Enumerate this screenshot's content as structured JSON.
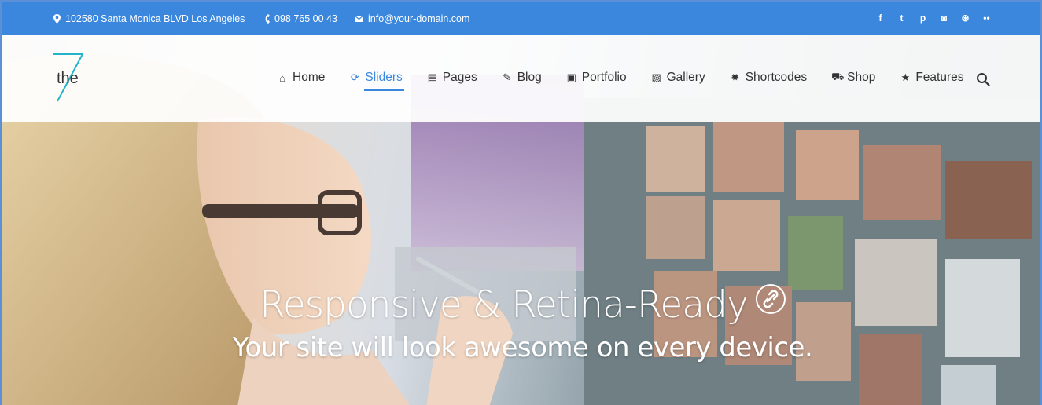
{
  "topbar": {
    "address": "102580 Santa Monica BLVD Los Angeles",
    "phone": "098 765 00 43",
    "email": "info@your-domain.com",
    "background": "#3b87de",
    "social": [
      {
        "icon": "facebook-icon",
        "glyph": "f"
      },
      {
        "icon": "twitter-icon",
        "glyph": "t"
      },
      {
        "icon": "pinterest-icon",
        "glyph": "p"
      },
      {
        "icon": "instagram-icon",
        "glyph": "◙"
      },
      {
        "icon": "dribbble-icon",
        "glyph": "⊛"
      },
      {
        "icon": "flickr-icon",
        "glyph": "••"
      }
    ]
  },
  "logo": {
    "text": "the"
  },
  "nav": {
    "items": [
      {
        "label": "Home",
        "icon": "home-icon",
        "glyph": "⌂"
      },
      {
        "label": "Sliders",
        "icon": "refresh-icon",
        "glyph": "⟳",
        "active": true
      },
      {
        "label": "Pages",
        "icon": "file-icon",
        "glyph": "▤"
      },
      {
        "label": "Blog",
        "icon": "pencil-icon",
        "glyph": "✎"
      },
      {
        "label": "Portfolio",
        "icon": "briefcase-icon",
        "glyph": "▣"
      },
      {
        "label": "Gallery",
        "icon": "image-icon",
        "glyph": "▨"
      },
      {
        "label": "Shortcodes",
        "icon": "gear-icon",
        "glyph": "✹"
      },
      {
        "label": "Shop",
        "icon": "cart-icon",
        "glyph": "⛟"
      },
      {
        "label": "Features",
        "icon": "star-icon",
        "glyph": "★"
      }
    ],
    "accent": "#3b87de"
  },
  "hero": {
    "title": "Responsive & Retina-Ready",
    "subtitle": "Your site will look awesome on every device."
  }
}
